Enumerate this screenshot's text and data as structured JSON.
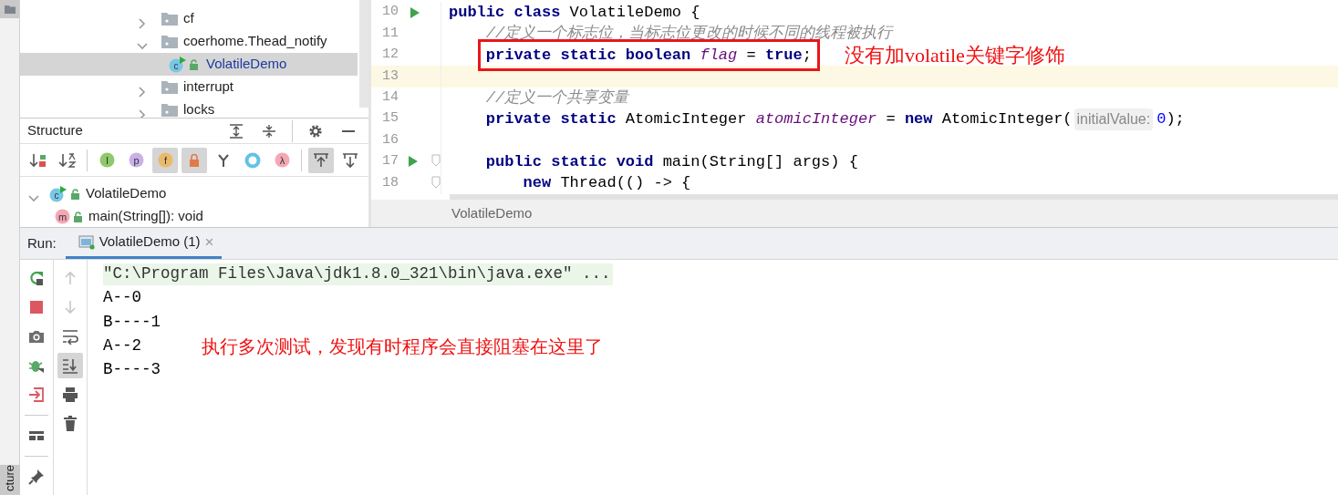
{
  "side_strip": {
    "tabs": [
      {
        "label": "cture",
        "selected": true
      }
    ]
  },
  "project_tree": {
    "items": [
      {
        "label": "cf",
        "kind": "package",
        "expanded": false,
        "selected": false
      },
      {
        "label": "coerhome.Thead_notify",
        "kind": "package",
        "expanded": true,
        "selected": false,
        "children": [
          {
            "label": "VolatileDemo",
            "kind": "class",
            "glyph": "c",
            "selected": true
          }
        ]
      },
      {
        "label": "interrupt",
        "kind": "package",
        "expanded": false,
        "selected": false
      },
      {
        "label": "locks",
        "kind": "package",
        "expanded": false,
        "selected": false
      }
    ]
  },
  "structure": {
    "title": "Structure",
    "header_tools": [
      {
        "kind": "expand-all"
      },
      {
        "kind": "collapse-all"
      },
      {
        "kind": "settings"
      },
      {
        "kind": "minimize"
      }
    ],
    "toolbar": [
      {
        "kind": "sort-visibility",
        "toggled": false
      },
      {
        "kind": "sort-alpha",
        "toggled": false
      },
      {
        "kind": "inherited",
        "glyph": "I",
        "toggled": false
      },
      {
        "kind": "property",
        "glyph": "p",
        "toggled": false
      },
      {
        "kind": "field",
        "glyph": "f",
        "toggled": true
      },
      {
        "kind": "non-public",
        "toggled": true
      },
      {
        "kind": "fork",
        "toggled": false
      },
      {
        "kind": "anonymous",
        "toggled": false
      },
      {
        "kind": "lambda",
        "glyph": "λ",
        "toggled": false
      },
      {
        "kind": "scroll-to-source",
        "toggled": true
      },
      {
        "kind": "scroll-from-source",
        "toggled": false
      }
    ],
    "items": [
      {
        "label": "VolatileDemo",
        "kind": "class",
        "glyph": "c",
        "expanded": true,
        "children": [
          {
            "label": "main(String[]): void",
            "kind": "method",
            "glyph": "m"
          }
        ]
      }
    ]
  },
  "editor": {
    "lines": [
      {
        "number": "10",
        "run": true,
        "tokens": [
          {
            "kind": "keyword",
            "text": "public class"
          },
          {
            "kind": "plain",
            "text": " VolatileDemo {"
          }
        ]
      },
      {
        "number": "11",
        "tokens": [
          {
            "kind": "comment",
            "text": "    //定义一个标志位，当标志位更改的时候不同的线程被执行"
          }
        ]
      },
      {
        "number": "12",
        "outlined": true,
        "note": "没有加volatile关键字修饰",
        "tokens": [
          {
            "kind": "keyword",
            "text": "private static boolean "
          },
          {
            "kind": "field",
            "text": "flag"
          },
          {
            "kind": "plain",
            "text": " = "
          },
          {
            "kind": "keyword",
            "text": "true"
          },
          {
            "kind": "plain",
            "text": ";"
          }
        ]
      },
      {
        "number": "13",
        "current": true
      },
      {
        "number": "14",
        "tokens": [
          {
            "kind": "comment",
            "text": "    //定义一个共享变量"
          }
        ]
      },
      {
        "number": "15",
        "tokens": [
          {
            "kind": "keyword",
            "text": "    private static"
          },
          {
            "kind": "plain",
            "text": " AtomicInteger "
          },
          {
            "kind": "field",
            "text": "atomicInteger"
          },
          {
            "kind": "plain",
            "text": " = "
          },
          {
            "kind": "keyword",
            "text": "new"
          },
          {
            "kind": "plain",
            "text": " AtomicInteger("
          },
          {
            "kind": "hint",
            "text": "initialValue:"
          },
          {
            "kind": "number",
            "text": "0"
          },
          {
            "kind": "plain",
            "text": ");"
          }
        ]
      },
      {
        "number": "16"
      },
      {
        "number": "17",
        "run": true,
        "fold": true,
        "tokens": [
          {
            "kind": "keyword",
            "text": "    public static void"
          },
          {
            "kind": "plain",
            "text": " main(String[] args) {"
          }
        ]
      },
      {
        "number": "18",
        "fold": true,
        "tokens": [
          {
            "kind": "keyword",
            "text": "        new"
          },
          {
            "kind": "plain",
            "text": " Thread(() -> {"
          }
        ]
      }
    ],
    "breadcrumb": "VolatileDemo"
  },
  "run": {
    "label": "Run:",
    "tabs": [
      {
        "label": "VolatileDemo (1)",
        "close": "×",
        "selected": true
      }
    ],
    "toolbar_left": [
      {
        "kind": "rerun"
      },
      {
        "kind": "stop"
      },
      {
        "kind": "camera"
      },
      {
        "kind": "debug"
      },
      {
        "kind": "exit"
      },
      {
        "kind": "layout"
      },
      {
        "kind": "pin"
      }
    ],
    "toolbar_right": [
      {
        "kind": "up",
        "disabled": true,
        "toggled": false
      },
      {
        "kind": "down",
        "disabled": true,
        "toggled": false
      },
      {
        "kind": "wrap",
        "disabled": false,
        "toggled": false
      },
      {
        "kind": "scroll-end",
        "disabled": false,
        "toggled": true
      },
      {
        "kind": "print",
        "disabled": false,
        "toggled": false
      },
      {
        "kind": "trash",
        "disabled": false,
        "toggled": false
      }
    ],
    "console": [
      {
        "kind": "command",
        "text": "\"C:\\Program Files\\Java\\jdk1.8.0_321\\bin\\java.exe\" ..."
      },
      {
        "kind": "output",
        "text": "A--0"
      },
      {
        "kind": "output",
        "text": "B----1"
      },
      {
        "kind": "output",
        "text": "A--2"
      },
      {
        "kind": "output",
        "text": "B----3"
      }
    ],
    "note": "执行多次测试，发现有时程序会直接阻塞在这里了"
  }
}
